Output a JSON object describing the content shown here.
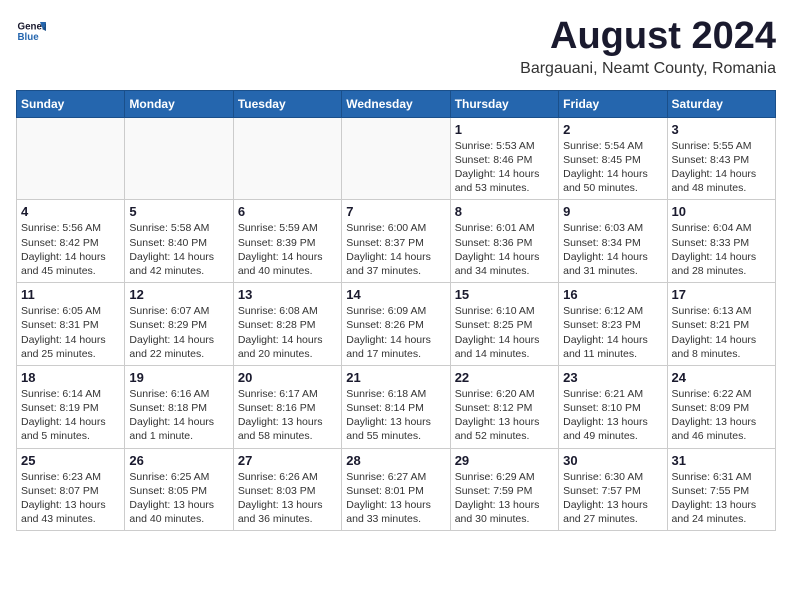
{
  "header": {
    "logo_line1": "General",
    "logo_line2": "Blue",
    "main_title": "August 2024",
    "subtitle": "Bargauani, Neamt County, Romania"
  },
  "calendar": {
    "days_of_week": [
      "Sunday",
      "Monday",
      "Tuesday",
      "Wednesday",
      "Thursday",
      "Friday",
      "Saturday"
    ],
    "weeks": [
      [
        {
          "day": "",
          "info": ""
        },
        {
          "day": "",
          "info": ""
        },
        {
          "day": "",
          "info": ""
        },
        {
          "day": "",
          "info": ""
        },
        {
          "day": "1",
          "info": "Sunrise: 5:53 AM\nSunset: 8:46 PM\nDaylight: 14 hours\nand 53 minutes."
        },
        {
          "day": "2",
          "info": "Sunrise: 5:54 AM\nSunset: 8:45 PM\nDaylight: 14 hours\nand 50 minutes."
        },
        {
          "day": "3",
          "info": "Sunrise: 5:55 AM\nSunset: 8:43 PM\nDaylight: 14 hours\nand 48 minutes."
        }
      ],
      [
        {
          "day": "4",
          "info": "Sunrise: 5:56 AM\nSunset: 8:42 PM\nDaylight: 14 hours\nand 45 minutes."
        },
        {
          "day": "5",
          "info": "Sunrise: 5:58 AM\nSunset: 8:40 PM\nDaylight: 14 hours\nand 42 minutes."
        },
        {
          "day": "6",
          "info": "Sunrise: 5:59 AM\nSunset: 8:39 PM\nDaylight: 14 hours\nand 40 minutes."
        },
        {
          "day": "7",
          "info": "Sunrise: 6:00 AM\nSunset: 8:37 PM\nDaylight: 14 hours\nand 37 minutes."
        },
        {
          "day": "8",
          "info": "Sunrise: 6:01 AM\nSunset: 8:36 PM\nDaylight: 14 hours\nand 34 minutes."
        },
        {
          "day": "9",
          "info": "Sunrise: 6:03 AM\nSunset: 8:34 PM\nDaylight: 14 hours\nand 31 minutes."
        },
        {
          "day": "10",
          "info": "Sunrise: 6:04 AM\nSunset: 8:33 PM\nDaylight: 14 hours\nand 28 minutes."
        }
      ],
      [
        {
          "day": "11",
          "info": "Sunrise: 6:05 AM\nSunset: 8:31 PM\nDaylight: 14 hours\nand 25 minutes."
        },
        {
          "day": "12",
          "info": "Sunrise: 6:07 AM\nSunset: 8:29 PM\nDaylight: 14 hours\nand 22 minutes."
        },
        {
          "day": "13",
          "info": "Sunrise: 6:08 AM\nSunset: 8:28 PM\nDaylight: 14 hours\nand 20 minutes."
        },
        {
          "day": "14",
          "info": "Sunrise: 6:09 AM\nSunset: 8:26 PM\nDaylight: 14 hours\nand 17 minutes."
        },
        {
          "day": "15",
          "info": "Sunrise: 6:10 AM\nSunset: 8:25 PM\nDaylight: 14 hours\nand 14 minutes."
        },
        {
          "day": "16",
          "info": "Sunrise: 6:12 AM\nSunset: 8:23 PM\nDaylight: 14 hours\nand 11 minutes."
        },
        {
          "day": "17",
          "info": "Sunrise: 6:13 AM\nSunset: 8:21 PM\nDaylight: 14 hours\nand 8 minutes."
        }
      ],
      [
        {
          "day": "18",
          "info": "Sunrise: 6:14 AM\nSunset: 8:19 PM\nDaylight: 14 hours\nand 5 minutes."
        },
        {
          "day": "19",
          "info": "Sunrise: 6:16 AM\nSunset: 8:18 PM\nDaylight: 14 hours\nand 1 minute."
        },
        {
          "day": "20",
          "info": "Sunrise: 6:17 AM\nSunset: 8:16 PM\nDaylight: 13 hours\nand 58 minutes."
        },
        {
          "day": "21",
          "info": "Sunrise: 6:18 AM\nSunset: 8:14 PM\nDaylight: 13 hours\nand 55 minutes."
        },
        {
          "day": "22",
          "info": "Sunrise: 6:20 AM\nSunset: 8:12 PM\nDaylight: 13 hours\nand 52 minutes."
        },
        {
          "day": "23",
          "info": "Sunrise: 6:21 AM\nSunset: 8:10 PM\nDaylight: 13 hours\nand 49 minutes."
        },
        {
          "day": "24",
          "info": "Sunrise: 6:22 AM\nSunset: 8:09 PM\nDaylight: 13 hours\nand 46 minutes."
        }
      ],
      [
        {
          "day": "25",
          "info": "Sunrise: 6:23 AM\nSunset: 8:07 PM\nDaylight: 13 hours\nand 43 minutes."
        },
        {
          "day": "26",
          "info": "Sunrise: 6:25 AM\nSunset: 8:05 PM\nDaylight: 13 hours\nand 40 minutes."
        },
        {
          "day": "27",
          "info": "Sunrise: 6:26 AM\nSunset: 8:03 PM\nDaylight: 13 hours\nand 36 minutes."
        },
        {
          "day": "28",
          "info": "Sunrise: 6:27 AM\nSunset: 8:01 PM\nDaylight: 13 hours\nand 33 minutes."
        },
        {
          "day": "29",
          "info": "Sunrise: 6:29 AM\nSunset: 7:59 PM\nDaylight: 13 hours\nand 30 minutes."
        },
        {
          "day": "30",
          "info": "Sunrise: 6:30 AM\nSunset: 7:57 PM\nDaylight: 13 hours\nand 27 minutes."
        },
        {
          "day": "31",
          "info": "Sunrise: 6:31 AM\nSunset: 7:55 PM\nDaylight: 13 hours\nand 24 minutes."
        }
      ]
    ]
  }
}
